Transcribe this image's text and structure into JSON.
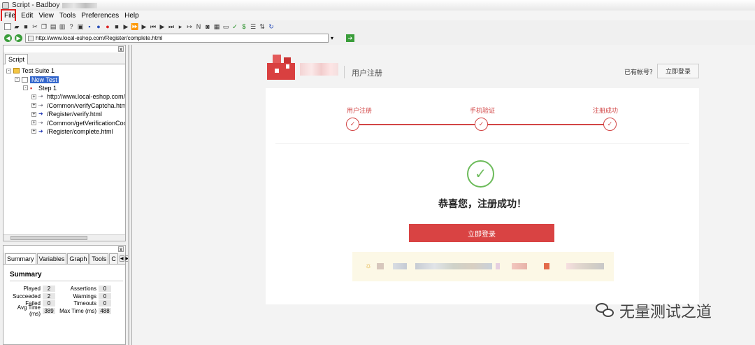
{
  "window": {
    "title": "Script - Badboy"
  },
  "menu": [
    "File",
    "Edit",
    "View",
    "Tools",
    "Preferences",
    "Help"
  ],
  "address": {
    "url": "http://www.local-eshop.com/Register/complete.html"
  },
  "script_panel": {
    "tab": "Script",
    "tree": [
      {
        "label": "Test Suite 1",
        "level": 0,
        "icon": "folder-icon"
      },
      {
        "label": "New Test",
        "level": 1,
        "icon": "page-icon",
        "selected": true
      },
      {
        "label": "Step 1",
        "level": 2,
        "icon": "step-icon"
      },
      {
        "label": "http://www.local-eshop.com/C",
        "level": 3,
        "icon": "arrow-icon"
      },
      {
        "label": "/Common/verifyCaptcha.html",
        "level": 3,
        "icon": "arrow-icon"
      },
      {
        "label": "/Register/verify.html",
        "level": 3,
        "icon": "arrowblue-icon"
      },
      {
        "label": "/Common/getVerificationCode",
        "level": 3,
        "icon": "arrow-icon"
      },
      {
        "label": "/Register/complete.html",
        "level": 3,
        "icon": "arrowblue-icon"
      }
    ]
  },
  "summary_panel": {
    "tabs": [
      "Summary",
      "Variables",
      "Graph",
      "Tools",
      "C"
    ],
    "title": "Summary",
    "stats": [
      {
        "label": "Played",
        "value": "2",
        "label2": "Assertions",
        "value2": "0"
      },
      {
        "label": "Succeeded",
        "value": "2",
        "label2": "Warnings",
        "value2": "0"
      },
      {
        "label": "Failed",
        "value": "0",
        "label2": "Timeouts",
        "value2": "0"
      },
      {
        "label": "Avg Time (ms)",
        "value": "389",
        "label2": "Max Time (ms)",
        "value2": "488"
      }
    ]
  },
  "page": {
    "header_title": "用户注册",
    "have_account": "已有帐号？",
    "login_top": "立即登录",
    "steps": [
      "用户注册",
      "手机验证",
      "注册成功"
    ],
    "success_text": "恭喜您，注册成功！",
    "login_button": "立即登录",
    "accent_color": "#d94343",
    "success_color": "#6cbb5a"
  },
  "watermark": {
    "text": "无量测试之道"
  }
}
